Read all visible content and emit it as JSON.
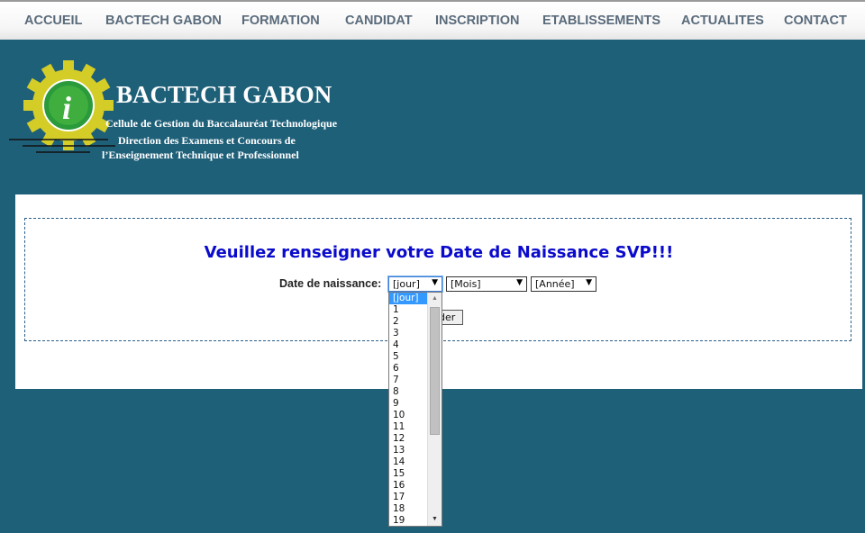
{
  "nav": {
    "items": [
      "ACCUEIL",
      "BACTECH GABON",
      "FORMATION",
      "CANDIDAT",
      "INSCRIPTION",
      "ETABLISSEMENTS",
      "ACTUALITES",
      "CONTACT"
    ]
  },
  "header": {
    "title": "BACTECH GABON",
    "subtitle_lines": [
      "Cellule de Gestion du Baccalauréat Technologique",
      "Direction des Examens et Concours de",
      "l’Enseignement Technique et Professionnel"
    ],
    "logo_letter": "i"
  },
  "form": {
    "heading": "Veuillez renseigner votre Date de Naissance SVP!!!",
    "dob_label": "Date de naissance:",
    "day_select_value": "[jour]",
    "month_select_value": "[Mois]",
    "year_select_value": "[Année]",
    "submit_label_visible": "der"
  },
  "day_dropdown": {
    "options": [
      "[jour]",
      "1",
      "2",
      "3",
      "4",
      "5",
      "6",
      "7",
      "8",
      "9",
      "10",
      "11",
      "12",
      "13",
      "14",
      "15",
      "16",
      "17",
      "18",
      "19"
    ],
    "selected": "[jour]"
  },
  "colors": {
    "page_background": "#1f6079",
    "nav_text": "#5a6b7b",
    "heading_text": "#0a0acc",
    "selected_option": "#3399ff",
    "logo_gear": "#d4cc27",
    "logo_circle": "#2a9a3a"
  },
  "icons": [
    "dropdown-arrow-icon",
    "scroll-up-arrow-icon",
    "scroll-down-arrow-icon",
    "info-gear-logo-icon"
  ]
}
